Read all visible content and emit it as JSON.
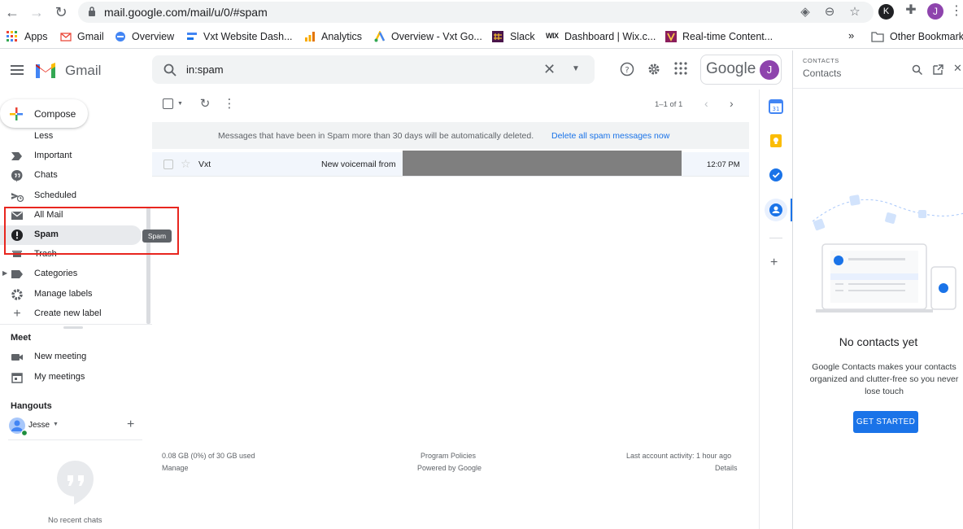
{
  "browser": {
    "url": "mail.google.com/mail/u/0/#spam",
    "profile_initial_k": "K",
    "profile_initial_j": "J",
    "bookmarks": [
      "Apps",
      "Gmail",
      "Overview",
      "Vxt Website Dash...",
      "Analytics",
      "Overview - Vxt Go...",
      "Slack",
      "Dashboard | Wix.c...",
      "Real-time Content..."
    ],
    "overflow": "»",
    "other_bookmarks": "Other Bookmarks"
  },
  "header": {
    "logo_text": "Gmail",
    "search_value": "in:spam",
    "account_brand": "Google",
    "account_initial": "J"
  },
  "sidebar": {
    "compose": "Compose",
    "items": [
      {
        "label": "Less",
        "icon": "chevron-up-icon"
      },
      {
        "label": "Important",
        "icon": "important-icon"
      },
      {
        "label": "Chats",
        "icon": "chat-icon"
      },
      {
        "label": "Scheduled",
        "icon": "scheduled-icon"
      },
      {
        "label": "All Mail",
        "icon": "mail-icon"
      },
      {
        "label": "Spam",
        "icon": "spam-icon"
      },
      {
        "label": "Trash",
        "icon": "trash-icon"
      },
      {
        "label": "Categories",
        "icon": "label-icon"
      },
      {
        "label": "Manage labels",
        "icon": "gear-icon"
      },
      {
        "label": "Create new label",
        "icon": "plus-icon"
      }
    ],
    "tooltip": "Spam",
    "meet_title": "Meet",
    "meet_items": [
      "New meeting",
      "My meetings"
    ],
    "hangouts_title": "Hangouts",
    "hangouts_user": "Jesse",
    "no_chats": "No recent chats"
  },
  "toolbar": {
    "pagination": "1–1 of 1"
  },
  "banner": {
    "text": "Messages that have been in Spam more than 30 days will be automatically deleted.",
    "action": "Delete all spam messages now"
  },
  "emails": [
    {
      "sender": "Vxt",
      "subject": "New voicemail from",
      "time": "12:07 PM"
    }
  ],
  "footer": {
    "storage": "0.08 GB (0%) of 30 GB used",
    "manage": "Manage",
    "policies": "Program Policies",
    "powered": "Powered by Google",
    "activity": "Last account activity: 1 hour ago",
    "details": "Details"
  },
  "contacts": {
    "kicker": "CONTACTS",
    "title": "Contacts",
    "empty_title": "No contacts yet",
    "empty_desc": "Google Contacts makes your contacts organized and clutter-free so you never lose touch",
    "cta": "GET STARTED"
  },
  "colors": {
    "accent": "#1a73e8",
    "highlight_box": "#e8261f",
    "avatar": "#8e44ad"
  }
}
